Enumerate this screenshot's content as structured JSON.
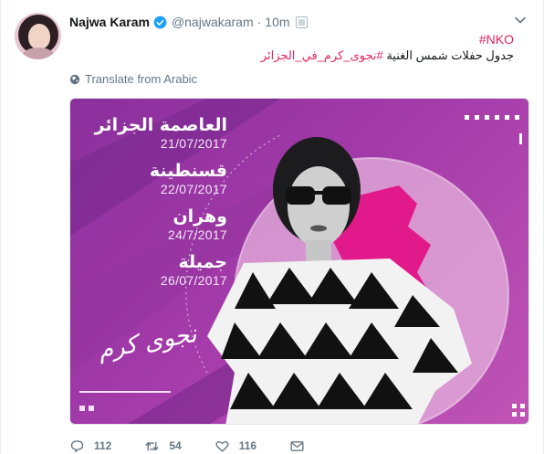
{
  "user": {
    "name": "Najwa Karam",
    "handle": "@najwakaram",
    "separator": "·",
    "time": "10m"
  },
  "tweet": {
    "hashtag_top": "#NKO",
    "arabic_text": "جدول حفلات شمس الغنية",
    "arabic_hashtag": "#نجوى_كرم_في_الجزائر",
    "translate_label": "Translate from Arabic"
  },
  "media": {
    "concerts": [
      {
        "city": "العاصمة الجزائر",
        "date": "21/07/2017"
      },
      {
        "city": "قسنطينة",
        "date": "22/07/2017"
      },
      {
        "city": "وهران",
        "date": "24/7/2017"
      },
      {
        "city": "جميلة",
        "date": "26/07/2017"
      }
    ],
    "signature": "نجوى كرم",
    "accent_colors": {
      "purple": "#8a2f9c",
      "pink": "#e2198a",
      "circle": "#e9b9e0"
    }
  },
  "actions": {
    "reply_count": "112",
    "retweet_count": "54",
    "like_count": "116"
  },
  "colors": {
    "link": "#e0245e",
    "muted": "#657786",
    "verified": "#1da1f2"
  }
}
